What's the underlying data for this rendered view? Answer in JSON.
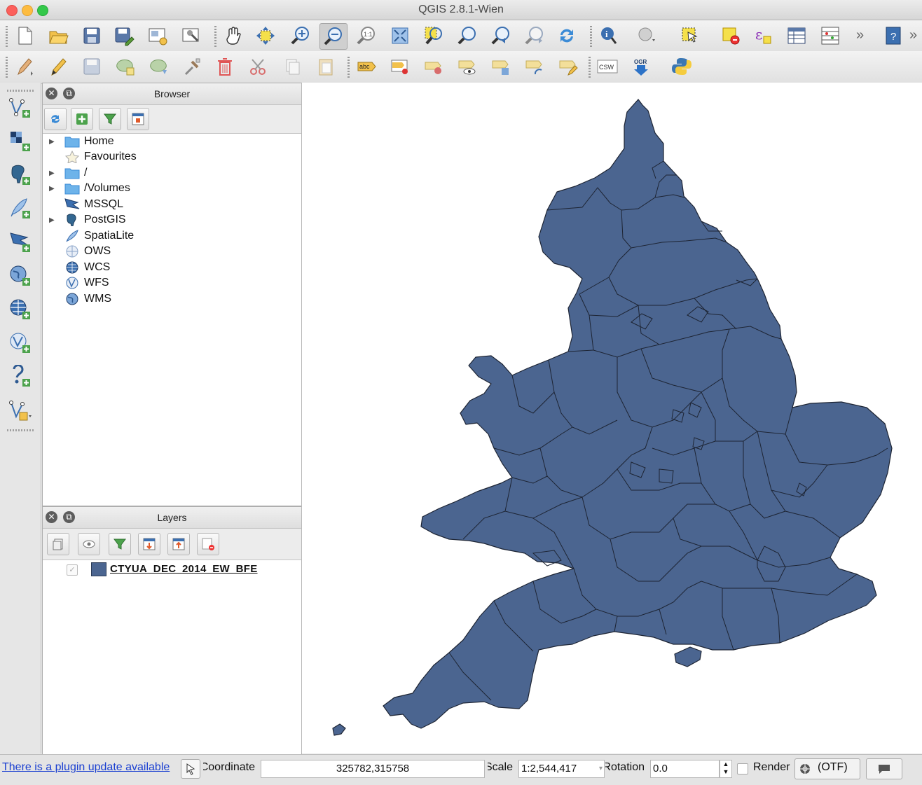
{
  "window": {
    "title": "QGIS 2.8.1-Wien"
  },
  "colors": {
    "feature_fill": "#4b6590",
    "feature_stroke": "#1d2433",
    "link": "#1a3fd1"
  },
  "toolbar1": {
    "icons": [
      "new-project-icon",
      "open-project-icon",
      "save-project-icon",
      "save-as-icon",
      "new-print-composer-icon",
      "composer-manager-icon",
      "pan-icon",
      "pan-to-selection-icon",
      "zoom-in-icon",
      "zoom-out-icon",
      "zoom-actual-size-icon",
      "zoom-full-icon",
      "zoom-to-selection-icon",
      "zoom-to-layer-icon",
      "zoom-last-icon",
      "zoom-next-icon",
      "refresh-icon",
      "identify-icon",
      "map-tips-icon",
      "select-features-icon",
      "deselect-icon",
      "expression-select-icon",
      "attribute-table-icon",
      "field-calculator-icon",
      "help-icon"
    ],
    "active": "zoom-out-icon"
  },
  "toolbar2": {
    "icons": [
      "current-edits-icon",
      "toggle-editing-icon",
      "save-layer-edits-icon",
      "add-feature-icon",
      "move-feature-icon",
      "node-tool-icon",
      "delete-selected-icon",
      "cut-features-icon",
      "copy-features-icon",
      "paste-features-icon",
      "label-icon",
      "pin-labels-icon",
      "highlight-pinned-labels-icon",
      "show-hide-labels-icon",
      "move-label-icon",
      "rotate-label-icon",
      "change-label-icon",
      "csw-icon",
      "ogr-converter-icon",
      "python-console-icon"
    ],
    "csw_label": "CSW",
    "label_abc": "abc",
    "ogr_label": "OGR"
  },
  "left_toolbar": {
    "icons": [
      "add-vector-layer-icon",
      "add-raster-layer-icon",
      "add-postgis-layer-icon",
      "add-spatialite-layer-icon",
      "add-mssql-layer-icon",
      "add-wms-layer-icon",
      "add-wcs-layer-icon",
      "add-wfs-layer-icon",
      "add-delimited-text-icon",
      "new-shapefile-icon"
    ]
  },
  "browser": {
    "title": "Browser",
    "tools": [
      "refresh-icon",
      "add-selected-icon",
      "filter-icon",
      "collapse-all-icon"
    ],
    "items": [
      {
        "label": "Home",
        "icon": "folder-icon",
        "expandable": true
      },
      {
        "label": "Favourites",
        "icon": "star-icon",
        "expandable": false
      },
      {
        "label": "/",
        "icon": "folder-icon",
        "expandable": true
      },
      {
        "label": "/Volumes",
        "icon": "folder-icon",
        "expandable": true
      },
      {
        "label": "MSSQL",
        "icon": "mssql-icon",
        "expandable": false
      },
      {
        "label": "PostGIS",
        "icon": "postgis-icon",
        "expandable": true
      },
      {
        "label": "SpatiaLite",
        "icon": "spatialite-icon",
        "expandable": false
      },
      {
        "label": "OWS",
        "icon": "ows-icon",
        "expandable": false
      },
      {
        "label": "WCS",
        "icon": "wcs-icon",
        "expandable": false
      },
      {
        "label": "WFS",
        "icon": "wfs-icon",
        "expandable": false
      },
      {
        "label": "WMS",
        "icon": "wms-icon",
        "expandable": false
      }
    ]
  },
  "layers": {
    "title": "Layers",
    "tools": [
      "add-group-icon",
      "manage-visibility-icon",
      "filter-legend-icon",
      "expand-all-icon",
      "collapse-all-icon",
      "remove-layer-icon"
    ],
    "items": [
      {
        "name": "CTYUA_DEC_2014_EW_BFE",
        "checked": true
      }
    ]
  },
  "status": {
    "plugin_update": "There is a plugin update available",
    "coordinate_label": "Coordinate",
    "coordinate_value": "325782,315758",
    "scale_label": "Scale",
    "scale_value": "1:2,544,417",
    "rotation_label": "Rotation",
    "rotation_value": "0.0",
    "render_label": "Render",
    "crs_label": "(OTF)"
  }
}
